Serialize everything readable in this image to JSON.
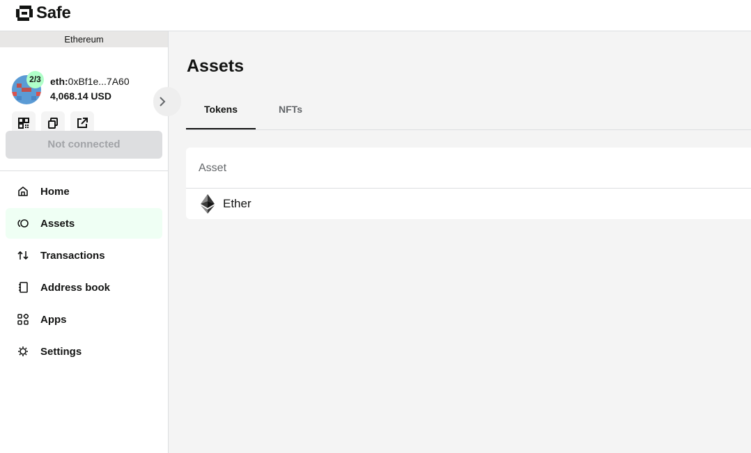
{
  "brand": {
    "name": "Safe"
  },
  "network": {
    "name": "Ethereum"
  },
  "safe": {
    "threshold": "2/3",
    "address_prefix": "eth:",
    "address": "0xBf1e...7A60",
    "balance": "4,068.14 USD"
  },
  "actions": [
    {
      "icon": "qr-code-icon"
    },
    {
      "icon": "copy-icon"
    },
    {
      "icon": "external-link-icon"
    }
  ],
  "connect": {
    "label": "Not connected"
  },
  "nav": {
    "items": [
      {
        "label": "Home",
        "icon": "home-icon",
        "active": false
      },
      {
        "label": "Assets",
        "icon": "assets-icon",
        "active": true
      },
      {
        "label": "Transactions",
        "icon": "transactions-icon",
        "active": false
      },
      {
        "label": "Address book",
        "icon": "address-book-icon",
        "active": false
      },
      {
        "label": "Apps",
        "icon": "apps-icon",
        "active": false
      },
      {
        "label": "Settings",
        "icon": "settings-icon",
        "active": false
      }
    ]
  },
  "main": {
    "title": "Assets",
    "tabs": [
      {
        "label": "Tokens",
        "active": true
      },
      {
        "label": "NFTs",
        "active": false
      }
    ],
    "table": {
      "header": "Asset",
      "rows": [
        {
          "name": "Ether",
          "icon": "ethereum-icon"
        }
      ]
    }
  },
  "colors": {
    "accent_green": "#b0ffc9",
    "active_nav_bg": "#effff4",
    "text_primary": "#121312",
    "text_secondary": "#636669"
  }
}
